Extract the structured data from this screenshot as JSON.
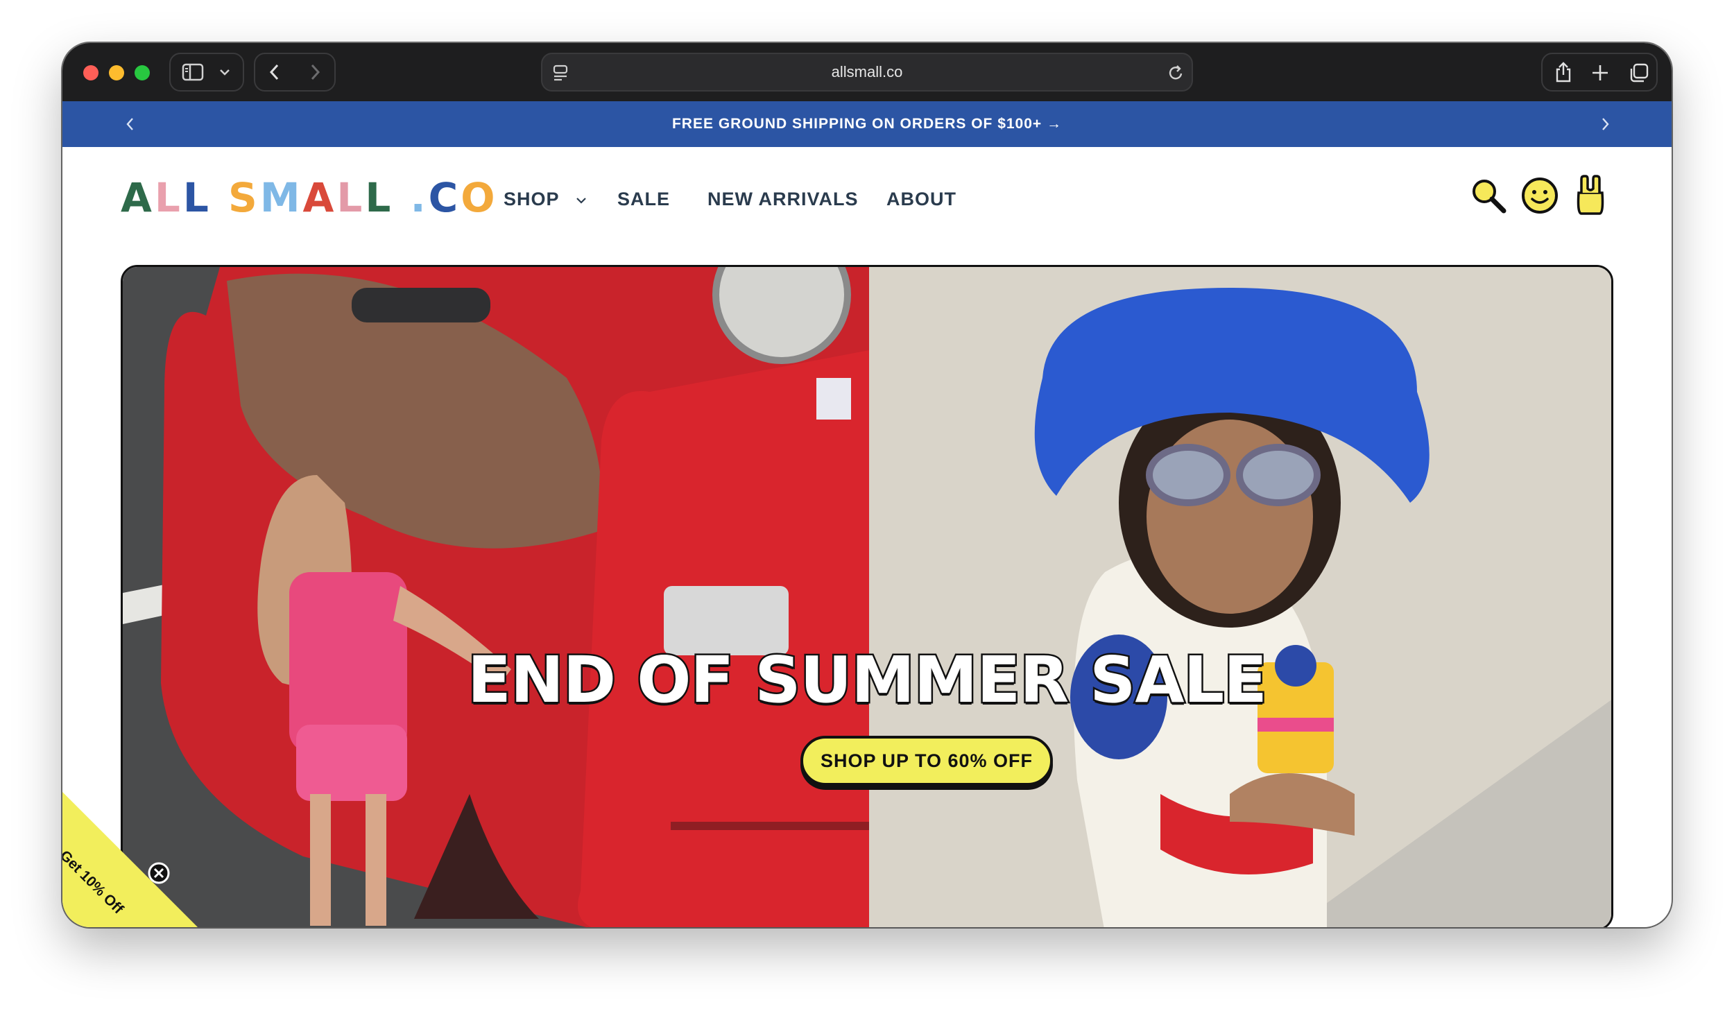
{
  "browser": {
    "url": "allsmall.co"
  },
  "announcement": {
    "text": "FREE GROUND SHIPPING ON ORDERS OF $100+ →"
  },
  "brand": {
    "logo_letters": [
      {
        "char": "A",
        "color": "#2e6a4a"
      },
      {
        "char": "L",
        "color": "#e9a0ad"
      },
      {
        "char": "L",
        "color": "#2c55a4"
      },
      {
        "char": " ",
        "color": "#000000"
      },
      {
        "char": "S",
        "color": "#f3a93b"
      },
      {
        "char": "M",
        "color": "#7fb8e6"
      },
      {
        "char": "A",
        "color": "#d9493a"
      },
      {
        "char": "L",
        "color": "#e39aa8"
      },
      {
        "char": "L",
        "color": "#2e6a4a"
      },
      {
        "char": " ",
        "color": "#000000"
      },
      {
        "char": ".",
        "color": "#7fb8e6"
      },
      {
        "char": "C",
        "color": "#2c55a4"
      },
      {
        "char": "O",
        "color": "#f3a93b"
      }
    ]
  },
  "nav": {
    "shop": "SHOP",
    "sale": "SALE",
    "new_arrivals": "NEW ARRIVALS",
    "about": "ABOUT"
  },
  "hero": {
    "headline": "END OF SUMMER SALE",
    "cta": "SHOP UP TO 60% OFF"
  },
  "promo": {
    "label": "Get 10% Off"
  },
  "colors": {
    "announcement_bg": "#2c55a4",
    "cta_bg": "#f2ee5c",
    "promo_bg": "#f2ee5c",
    "nav_text": "#2a3b4d"
  }
}
